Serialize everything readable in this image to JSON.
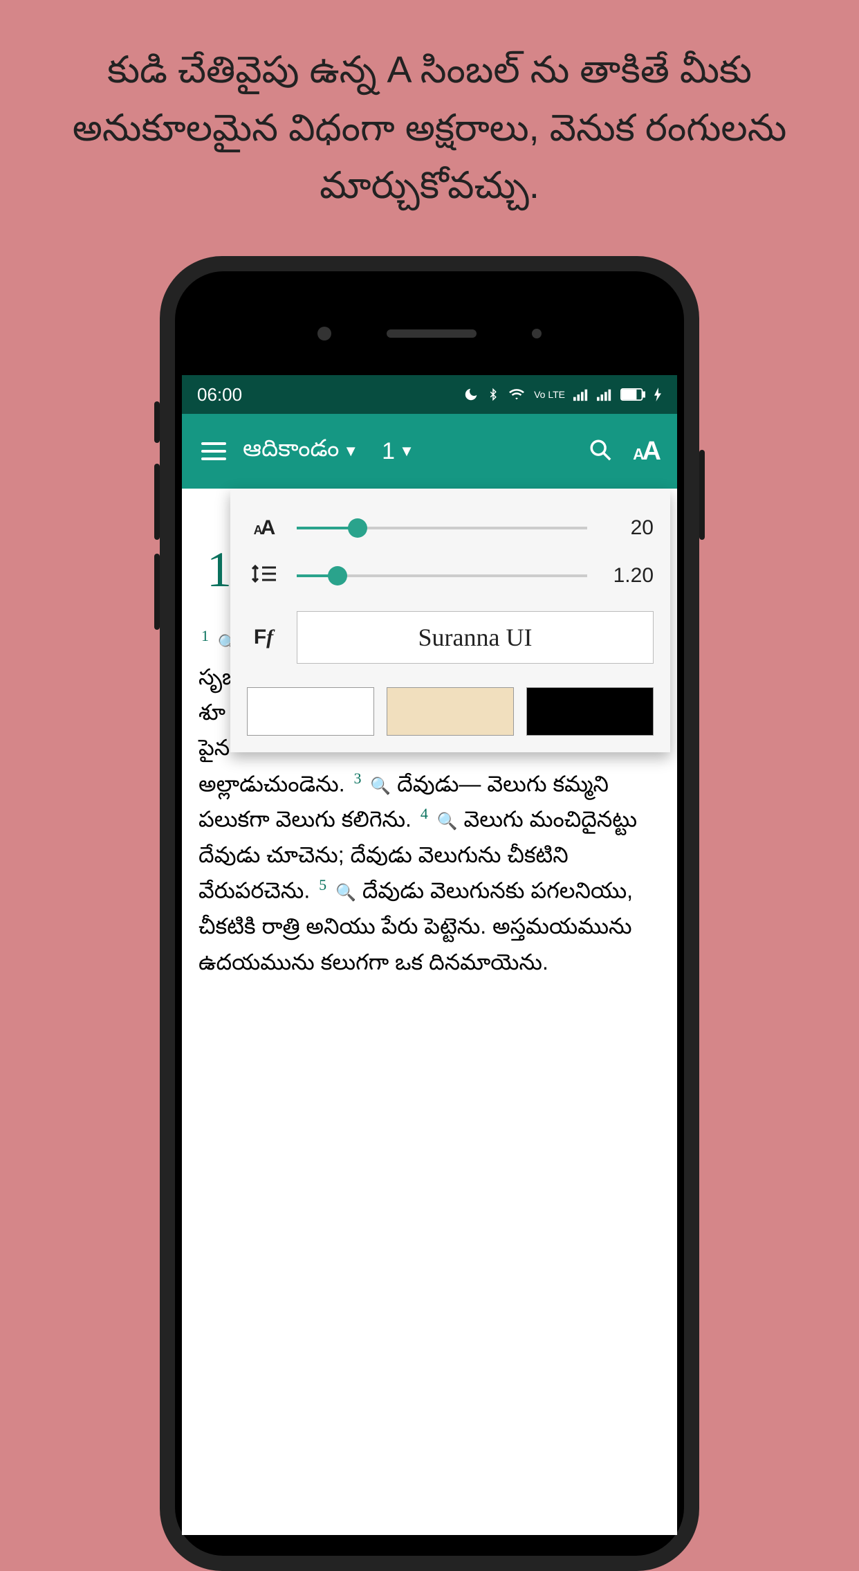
{
  "caption": "కుడి చేతివైపు ఉన్న A సింబల్ ను తాకితే మీకు అనుకూలమైన విధంగా అక్షరాలు, వెనుక రంగులను మార్చుకోవచ్చు.",
  "statusbar": {
    "time": "06:00",
    "volte": "Vo LTE"
  },
  "appbar": {
    "book": "ఆదికాండం",
    "chapter": "1"
  },
  "popover": {
    "fontsize_val": "20",
    "fontsize_pct": 21,
    "linespacing_val": "1.20",
    "linespacing_pct": 14,
    "font_name": "Suranna UI"
  },
  "content": {
    "chapter": "1",
    "v1": "1",
    "t1": "సృజి",
    "t2": "శూ",
    "t3": "పైన",
    "t4": "అల్లాడుచుండెను.",
    "v3": "3",
    "t5": "దేవుడు— వెలుగు కమ్మని పలుకగా వెలుగు కలిగెను.",
    "v4": "4",
    "t6": "వెలుగు మంచిదైనట్టు దేవుడు చూచెను; దేవుడు వెలుగును చీకటిని వేరుపరచెను.",
    "v5": "5",
    "t7": "దేవుడు వెలుగునకు పగలనియు, చీకటికి రాత్రి అనియు పేరు పెట్టెను. అస్తమయమును ఉదయమును కలుగగా ఒక దినమాయెను."
  }
}
